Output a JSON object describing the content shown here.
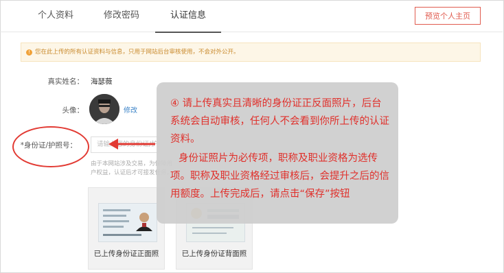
{
  "tabs": [
    {
      "label": "个人资料"
    },
    {
      "label": "修改密码"
    },
    {
      "label": "认证信息"
    }
  ],
  "preview_button": "预览个人主页",
  "notice": "您在此上传的所有认证资料与信息，只用于网站后台审核使用，不会对外公开。",
  "form": {
    "name_label": "真实姓名：",
    "name_value": "海瑟薇",
    "avatar_label": "头像：",
    "avatar_edit": "修改",
    "id_label": "*身份证/护照号：",
    "id_placeholder": "请输入您的身份证/护照号",
    "hint": "由于本网站涉及交易，为保障用户权益，认证后才可接发任务，身份证照片为必传项"
  },
  "cards": [
    {
      "caption": "已上传身份证正面照"
    },
    {
      "caption": "已上传身份证背面照"
    }
  ],
  "overlay": {
    "line1": "④ 请上传真实且清晰的身份证正反面照片，后台系统会自动审核，任何人不会看到你所上传的认证资料。",
    "line2": "身份证照片为必传项，职称及职业资格为选传项。职称及职业资格经过审核后，会提升之后的信用额度。上传完成后，请点击“保存”按钮"
  },
  "colors": {
    "accent": "#e05a4e",
    "overlay_text": "#e0302b",
    "link": "#3d84c8"
  }
}
